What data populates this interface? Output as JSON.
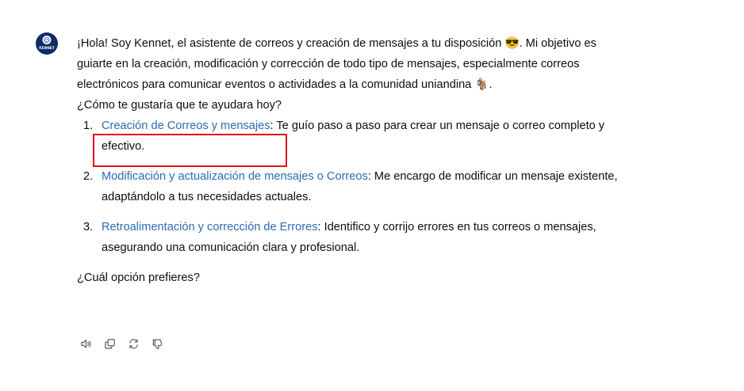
{
  "assistant": {
    "avatar_text": "KENNET"
  },
  "message": {
    "intro_line": "¡Hola! Soy Kennet, el asistente de correos y creación de mensajes a tu disposición 😎. Mi objetivo es guiarte en la creación, modificación y corrección de todo tipo de mensajes, especialmente correos electrónicos para comunicar eventos o actividades a la comunidad uniandina 🐐.",
    "question": "¿Cómo te gustaría que te ayudara hoy?",
    "options": [
      {
        "number": "1.",
        "title": "Creación de Correos y mensajes",
        "description": ": Te guío paso a paso para crear un mensaje o correo completo y efectivo."
      },
      {
        "number": "2.",
        "title": "Modificación y actualización de mensajes o Correos",
        "description": ": Me encargo de modificar un mensaje existente, adaptándolo a tus necesidades actuales."
      },
      {
        "number": "3.",
        "title": "Retroalimentación y corrección de Errores",
        "description": ": Identifico y corrijo errores en tus correos o mensajes, asegurando una comunicación clara y profesional."
      }
    ],
    "closing": "¿Cuál opción prefieres?"
  },
  "actions": [
    {
      "icon": "speaker-icon"
    },
    {
      "icon": "copy-icon"
    },
    {
      "icon": "regenerate-icon"
    },
    {
      "icon": "thumbs-down-icon"
    }
  ],
  "colors": {
    "link": "#2b6cb0",
    "highlight_border": "#e0101a",
    "avatar_bg": "#0f2d63"
  }
}
